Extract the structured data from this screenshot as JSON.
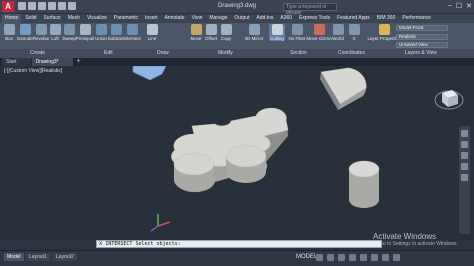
{
  "app": {
    "logo": "A",
    "title": "Drawing3.dwg",
    "search_placeholder": "Type a keyword or phrase"
  },
  "ribbon_tabs": [
    "Home",
    "Solid",
    "Surface",
    "Mesh",
    "Visualize",
    "Parametric",
    "Insert",
    "Annotate",
    "View",
    "Manage",
    "Output",
    "Add-ins",
    "A360",
    "Express Tools",
    "Featured Apps",
    "BIM 360",
    "Performance"
  ],
  "ribbon_tools": [
    "Box",
    "Extrude",
    "Revolve",
    "Loft",
    "Sweep",
    "Presspull",
    "Union",
    "Subtract",
    "Intersect",
    "Line",
    "Move",
    "Offset",
    "Copy",
    "3D Mirror",
    "Culling",
    "No Filter",
    "Move Gizmo",
    "World",
    "X",
    "Layer Properties"
  ],
  "ribbon_groups": [
    "Create",
    "Edit",
    "Draw",
    "Modify",
    "Section",
    "Coordinates",
    "Layers & View"
  ],
  "ribbon_dropdowns": {
    "visual_style": "Realistic",
    "view": "Unsaved View",
    "layer_field": "Model-Front"
  },
  "file_tabs": [
    "Start",
    "Drawing3*"
  ],
  "viewport": {
    "label": "[-][Custom View][Realistic]"
  },
  "command_line": {
    "close": "X",
    "text": "INTERSECT Select objects:"
  },
  "layout_tabs": [
    "Model",
    "Layout1",
    "Layout2"
  ],
  "status": {
    "model": "MODEL"
  },
  "watermark": {
    "title": "Activate Windows",
    "subtitle": "Go to Settings to activate Windows."
  },
  "colors": {
    "viewport_bg": "#27303b",
    "solid_top": "#d6d6d3",
    "solid_side": "#9c9c99",
    "accent": "#c5283d"
  }
}
